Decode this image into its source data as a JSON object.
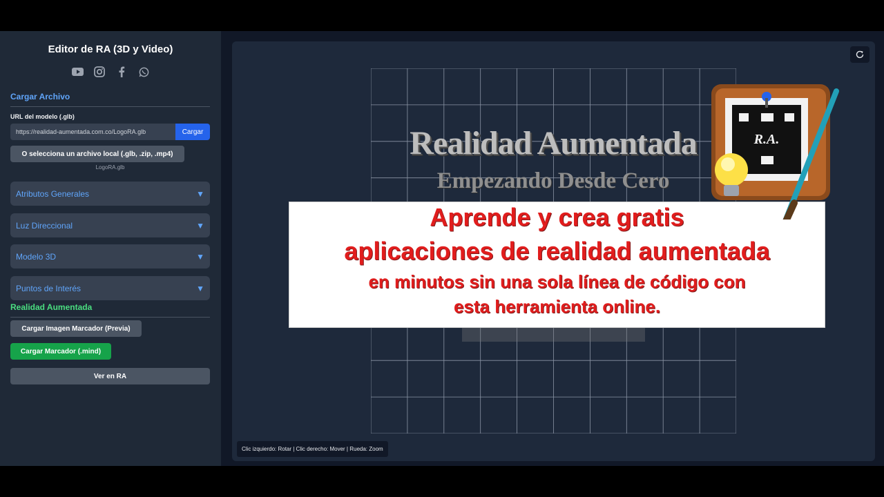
{
  "app": {
    "title": "Editor de RA (3D y Video)",
    "socials": [
      "youtube-icon",
      "instagram-icon",
      "facebook-icon",
      "whatsapp-icon"
    ]
  },
  "load_section": {
    "title": "Cargar Archivo",
    "url_label": "URL del modelo (.glb)",
    "url_value": "https://realidad-aumentada.com.co/LogoRA.glb",
    "load_button": "Cargar",
    "local_button": "O selecciona un archivo local (.glb, .zip, .mp4)",
    "file_name": "LogoRA.glb"
  },
  "accordions": [
    {
      "label": "Atributos Generales",
      "arrow": "▼"
    },
    {
      "label": "Luz Direccional",
      "arrow": "▼"
    },
    {
      "label": "Modelo 3D",
      "arrow": "▼"
    },
    {
      "label": "Puntos de Interés",
      "arrow": "▼"
    }
  ],
  "ar_section": {
    "title": "Realidad Aumentada",
    "marker_image_button": "Cargar Imagen Marcador (Previa)",
    "marker_mind_button": "Cargar Marcador (.mind)",
    "view_ar_button": "Ver en RA"
  },
  "viewport": {
    "hint": "Clic izquierdo: Rotar | Clic derecho: Mover | Rueda: Zoom",
    "overlay_title": "Realidad Aumentada",
    "overlay_subtitle": "Empezando Desde Cero",
    "promo": {
      "line1": "Aprende y crea gratis",
      "line2": "aplicaciones de realidad aumentada",
      "line3": "en minutos sin una sola línea de código con",
      "line4": "esta herramienta online."
    },
    "logo_text": "R.A."
  },
  "colors": {
    "accent_blue": "#60a5fa",
    "button_blue": "#2563eb",
    "accent_green": "#16a34a",
    "promo_red": "#e11d1d"
  }
}
